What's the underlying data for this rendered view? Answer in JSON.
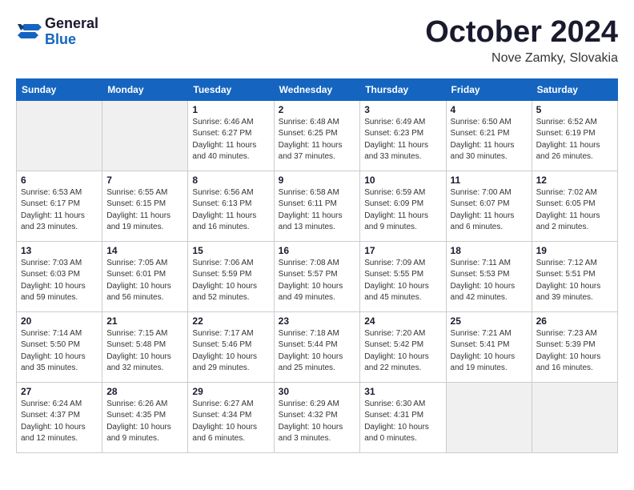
{
  "logo": {
    "general": "General",
    "blue": "Blue"
  },
  "title": "October 2024",
  "subtitle": "Nove Zamky, Slovakia",
  "weekdays": [
    "Sunday",
    "Monday",
    "Tuesday",
    "Wednesday",
    "Thursday",
    "Friday",
    "Saturday"
  ],
  "weeks": [
    [
      {
        "day": "",
        "sunrise": "",
        "sunset": "",
        "daylight": ""
      },
      {
        "day": "",
        "sunrise": "",
        "sunset": "",
        "daylight": ""
      },
      {
        "day": "1",
        "sunrise": "Sunrise: 6:46 AM",
        "sunset": "Sunset: 6:27 PM",
        "daylight": "Daylight: 11 hours and 40 minutes."
      },
      {
        "day": "2",
        "sunrise": "Sunrise: 6:48 AM",
        "sunset": "Sunset: 6:25 PM",
        "daylight": "Daylight: 11 hours and 37 minutes."
      },
      {
        "day": "3",
        "sunrise": "Sunrise: 6:49 AM",
        "sunset": "Sunset: 6:23 PM",
        "daylight": "Daylight: 11 hours and 33 minutes."
      },
      {
        "day": "4",
        "sunrise": "Sunrise: 6:50 AM",
        "sunset": "Sunset: 6:21 PM",
        "daylight": "Daylight: 11 hours and 30 minutes."
      },
      {
        "day": "5",
        "sunrise": "Sunrise: 6:52 AM",
        "sunset": "Sunset: 6:19 PM",
        "daylight": "Daylight: 11 hours and 26 minutes."
      }
    ],
    [
      {
        "day": "6",
        "sunrise": "Sunrise: 6:53 AM",
        "sunset": "Sunset: 6:17 PM",
        "daylight": "Daylight: 11 hours and 23 minutes."
      },
      {
        "day": "7",
        "sunrise": "Sunrise: 6:55 AM",
        "sunset": "Sunset: 6:15 PM",
        "daylight": "Daylight: 11 hours and 19 minutes."
      },
      {
        "day": "8",
        "sunrise": "Sunrise: 6:56 AM",
        "sunset": "Sunset: 6:13 PM",
        "daylight": "Daylight: 11 hours and 16 minutes."
      },
      {
        "day": "9",
        "sunrise": "Sunrise: 6:58 AM",
        "sunset": "Sunset: 6:11 PM",
        "daylight": "Daylight: 11 hours and 13 minutes."
      },
      {
        "day": "10",
        "sunrise": "Sunrise: 6:59 AM",
        "sunset": "Sunset: 6:09 PM",
        "daylight": "Daylight: 11 hours and 9 minutes."
      },
      {
        "day": "11",
        "sunrise": "Sunrise: 7:00 AM",
        "sunset": "Sunset: 6:07 PM",
        "daylight": "Daylight: 11 hours and 6 minutes."
      },
      {
        "day": "12",
        "sunrise": "Sunrise: 7:02 AM",
        "sunset": "Sunset: 6:05 PM",
        "daylight": "Daylight: 11 hours and 2 minutes."
      }
    ],
    [
      {
        "day": "13",
        "sunrise": "Sunrise: 7:03 AM",
        "sunset": "Sunset: 6:03 PM",
        "daylight": "Daylight: 10 hours and 59 minutes."
      },
      {
        "day": "14",
        "sunrise": "Sunrise: 7:05 AM",
        "sunset": "Sunset: 6:01 PM",
        "daylight": "Daylight: 10 hours and 56 minutes."
      },
      {
        "day": "15",
        "sunrise": "Sunrise: 7:06 AM",
        "sunset": "Sunset: 5:59 PM",
        "daylight": "Daylight: 10 hours and 52 minutes."
      },
      {
        "day": "16",
        "sunrise": "Sunrise: 7:08 AM",
        "sunset": "Sunset: 5:57 PM",
        "daylight": "Daylight: 10 hours and 49 minutes."
      },
      {
        "day": "17",
        "sunrise": "Sunrise: 7:09 AM",
        "sunset": "Sunset: 5:55 PM",
        "daylight": "Daylight: 10 hours and 45 minutes."
      },
      {
        "day": "18",
        "sunrise": "Sunrise: 7:11 AM",
        "sunset": "Sunset: 5:53 PM",
        "daylight": "Daylight: 10 hours and 42 minutes."
      },
      {
        "day": "19",
        "sunrise": "Sunrise: 7:12 AM",
        "sunset": "Sunset: 5:51 PM",
        "daylight": "Daylight: 10 hours and 39 minutes."
      }
    ],
    [
      {
        "day": "20",
        "sunrise": "Sunrise: 7:14 AM",
        "sunset": "Sunset: 5:50 PM",
        "daylight": "Daylight: 10 hours and 35 minutes."
      },
      {
        "day": "21",
        "sunrise": "Sunrise: 7:15 AM",
        "sunset": "Sunset: 5:48 PM",
        "daylight": "Daylight: 10 hours and 32 minutes."
      },
      {
        "day": "22",
        "sunrise": "Sunrise: 7:17 AM",
        "sunset": "Sunset: 5:46 PM",
        "daylight": "Daylight: 10 hours and 29 minutes."
      },
      {
        "day": "23",
        "sunrise": "Sunrise: 7:18 AM",
        "sunset": "Sunset: 5:44 PM",
        "daylight": "Daylight: 10 hours and 25 minutes."
      },
      {
        "day": "24",
        "sunrise": "Sunrise: 7:20 AM",
        "sunset": "Sunset: 5:42 PM",
        "daylight": "Daylight: 10 hours and 22 minutes."
      },
      {
        "day": "25",
        "sunrise": "Sunrise: 7:21 AM",
        "sunset": "Sunset: 5:41 PM",
        "daylight": "Daylight: 10 hours and 19 minutes."
      },
      {
        "day": "26",
        "sunrise": "Sunrise: 7:23 AM",
        "sunset": "Sunset: 5:39 PM",
        "daylight": "Daylight: 10 hours and 16 minutes."
      }
    ],
    [
      {
        "day": "27",
        "sunrise": "Sunrise: 6:24 AM",
        "sunset": "Sunset: 4:37 PM",
        "daylight": "Daylight: 10 hours and 12 minutes."
      },
      {
        "day": "28",
        "sunrise": "Sunrise: 6:26 AM",
        "sunset": "Sunset: 4:35 PM",
        "daylight": "Daylight: 10 hours and 9 minutes."
      },
      {
        "day": "29",
        "sunrise": "Sunrise: 6:27 AM",
        "sunset": "Sunset: 4:34 PM",
        "daylight": "Daylight: 10 hours and 6 minutes."
      },
      {
        "day": "30",
        "sunrise": "Sunrise: 6:29 AM",
        "sunset": "Sunset: 4:32 PM",
        "daylight": "Daylight: 10 hours and 3 minutes."
      },
      {
        "day": "31",
        "sunrise": "Sunrise: 6:30 AM",
        "sunset": "Sunset: 4:31 PM",
        "daylight": "Daylight: 10 hours and 0 minutes."
      },
      {
        "day": "",
        "sunrise": "",
        "sunset": "",
        "daylight": ""
      },
      {
        "day": "",
        "sunrise": "",
        "sunset": "",
        "daylight": ""
      }
    ]
  ]
}
